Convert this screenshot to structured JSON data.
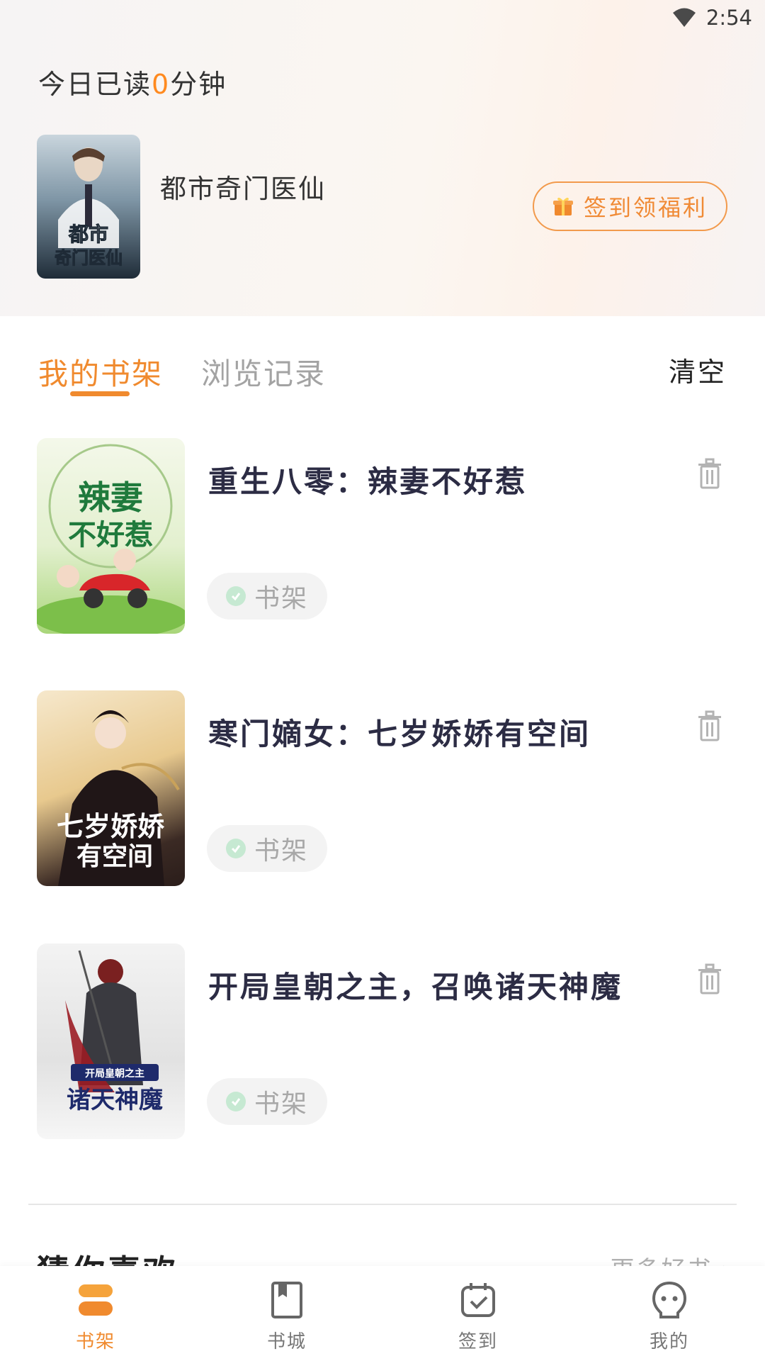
{
  "status_bar": {
    "time": "2:54"
  },
  "header": {
    "reading_prefix": "今日已读",
    "reading_minutes": "0",
    "reading_suffix": "分钟",
    "featured_book_title": "都市奇门医仙",
    "featured_cover_text_line1": "都市",
    "featured_cover_text_line2": "奇门医仙",
    "signin_label": "签到领福利"
  },
  "tabs": {
    "my_shelf": "我的书架",
    "history": "浏览记录",
    "clear": "清空"
  },
  "books": [
    {
      "title": "重生八零：辣妻不好惹",
      "cover_text_line1": "辣妻",
      "cover_text_line2": "不好惹",
      "badge": "书架"
    },
    {
      "title": "寒门嫡女：七岁娇娇有空间",
      "cover_text_line1": "七岁娇娇",
      "cover_text_line2": "有空间",
      "badge": "书架"
    },
    {
      "title": "开局皇朝之主，召唤诸天神魔",
      "cover_text_line1": "开局皇朝之主",
      "cover_text_line2": "诸天神魔",
      "badge": "书架"
    }
  ],
  "recommend": {
    "title": "猜你喜欢",
    "more": "更多好书 ›"
  },
  "bottom_nav": [
    {
      "label": "书架",
      "active": true
    },
    {
      "label": "书城",
      "active": false
    },
    {
      "label": "签到",
      "active": false
    },
    {
      "label": "我的",
      "active": false
    }
  ],
  "colors": {
    "accent": "#f08a2e",
    "title_text": "#2c2c44",
    "muted": "#a3a3a3"
  }
}
